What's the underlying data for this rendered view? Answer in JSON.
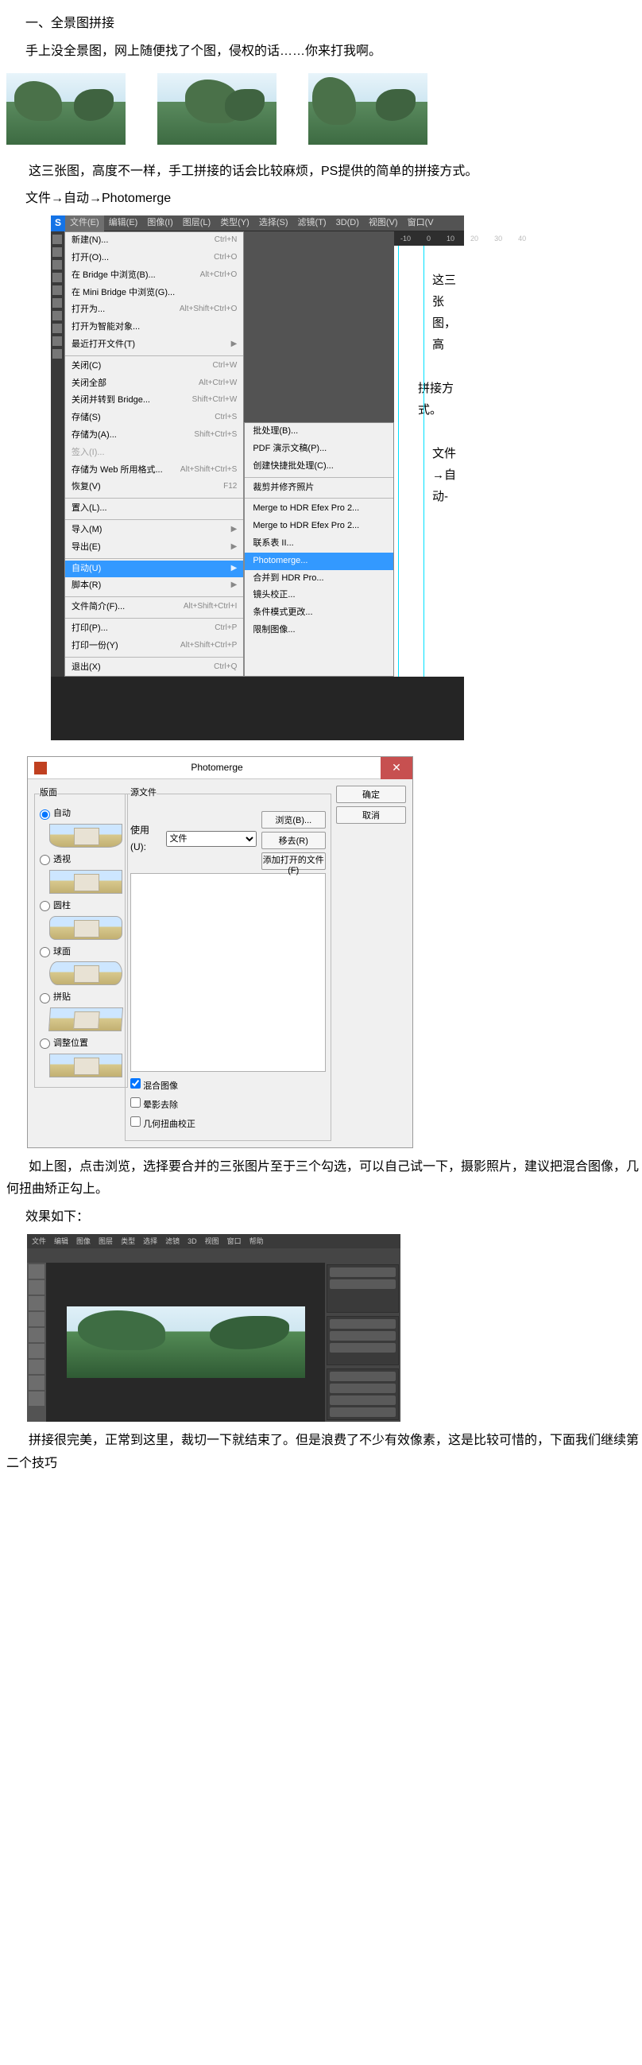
{
  "section_title": "一、全景图拼接",
  "para1": "手上没全景图，网上随便找了个图，侵权的话……你来打我啊。",
  "para2": "这三张图，高度不一样，手工拼接的话会比较麻烦，PS提供的简单的拼接方式。",
  "para3": "文件→自动→Photomerge",
  "para4": "如上图，点击浏览，选择要合并的三张图片至于三个勾选，可以自己试一下，摄影照片，建议把混合图像，几何扭曲矫正勾上。",
  "para5": "效果如下：",
  "para6": "拼接很完美，正常到这里，裁切一下就结束了。但是浪费了不少有效像素，这是比较可惜的，下面我们继续第二个技巧",
  "ps_menu": {
    "logo": "S",
    "menubar": [
      "文件(E)",
      "编辑(E)",
      "图像(I)",
      "图层(L)",
      "类型(Y)",
      "选择(S)",
      "滤镜(T)",
      "3D(D)",
      "视图(V)",
      "窗口(V"
    ],
    "ruler": [
      "-10",
      "0",
      "10",
      "20",
      "30",
      "40"
    ],
    "items": [
      {
        "label": "新建(N)...",
        "sc": "Ctrl+N"
      },
      {
        "label": "打开(O)...",
        "sc": "Ctrl+O"
      },
      {
        "label": "在 Bridge 中浏览(B)...",
        "sc": "Alt+Ctrl+O"
      },
      {
        "label": "在 Mini Bridge 中浏览(G)...",
        "sc": ""
      },
      {
        "label": "打开为...",
        "sc": "Alt+Shift+Ctrl+O"
      },
      {
        "label": "打开为智能对象...",
        "sc": ""
      },
      {
        "label": "最近打开文件(T)",
        "sc": "",
        "arrow": true
      },
      {
        "sep": true
      },
      {
        "label": "关闭(C)",
        "sc": "Ctrl+W"
      },
      {
        "label": "关闭全部",
        "sc": "Alt+Ctrl+W"
      },
      {
        "label": "关闭并转到 Bridge...",
        "sc": "Shift+Ctrl+W"
      },
      {
        "label": "存储(S)",
        "sc": "Ctrl+S"
      },
      {
        "label": "存储为(A)...",
        "sc": "Shift+Ctrl+S"
      },
      {
        "label": "签入(I)...",
        "sc": "",
        "dis": true
      },
      {
        "label": "存储为 Web 所用格式...",
        "sc": "Alt+Shift+Ctrl+S"
      },
      {
        "label": "恢复(V)",
        "sc": "F12"
      },
      {
        "sep": true
      },
      {
        "label": "置入(L)...",
        "sc": ""
      },
      {
        "sep": true
      },
      {
        "label": "导入(M)",
        "sc": "",
        "arrow": true
      },
      {
        "label": "导出(E)",
        "sc": "",
        "arrow": true
      },
      {
        "sep": true
      },
      {
        "label": "自动(U)",
        "sc": "",
        "arrow": true,
        "hl": true
      },
      {
        "label": "脚本(R)",
        "sc": "",
        "arrow": true
      },
      {
        "sep": true
      },
      {
        "label": "文件简介(F)...",
        "sc": "Alt+Shift+Ctrl+I"
      },
      {
        "sep": true
      },
      {
        "label": "打印(P)...",
        "sc": "Ctrl+P"
      },
      {
        "label": "打印一份(Y)",
        "sc": "Alt+Shift+Ctrl+P"
      },
      {
        "sep": true
      },
      {
        "label": "退出(X)",
        "sc": "Ctrl+Q"
      }
    ],
    "submenu": [
      {
        "label": "批处理(B)..."
      },
      {
        "label": "PDF 演示文稿(P)..."
      },
      {
        "label": "创建快捷批处理(C)..."
      },
      {
        "sep": true
      },
      {
        "label": "裁剪并修齐照片"
      },
      {
        "sep": true
      },
      {
        "label": "Merge to HDR Efex Pro 2..."
      },
      {
        "label": "Merge to HDR Efex Pro 2..."
      },
      {
        "label": "联系表 II..."
      },
      {
        "label": "Photomerge...",
        "hl": true
      },
      {
        "label": "合并到 HDR Pro..."
      },
      {
        "label": "镜头校正..."
      },
      {
        "label": "条件模式更改..."
      },
      {
        "label": "限制图像..."
      }
    ],
    "canvas_lines": [
      "这三张图，高",
      "拼接方式。",
      "文件→自动-"
    ]
  },
  "dialog": {
    "title": "Photomerge",
    "close": "✕",
    "left_legend": "版面",
    "layouts": [
      "自动",
      "透视",
      "圆柱",
      "球面",
      "拼贴",
      "调整位置"
    ],
    "mid_legend": "源文件",
    "use_label": "使用(U):",
    "use_value": "文件",
    "browse": "浏览(B)...",
    "remove": "移去(R)",
    "addopen": "添加打开的文件(F)",
    "chk_blend": "混合图像",
    "chk_vignette": "晕影去除",
    "chk_geo": "几何扭曲校正",
    "ok": "确定",
    "cancel": "取消"
  },
  "ps_result_menubar": [
    "文件",
    "编辑",
    "图像",
    "图层",
    "类型",
    "选择",
    "滤镜",
    "3D",
    "视图",
    "窗口",
    "帮助"
  ]
}
